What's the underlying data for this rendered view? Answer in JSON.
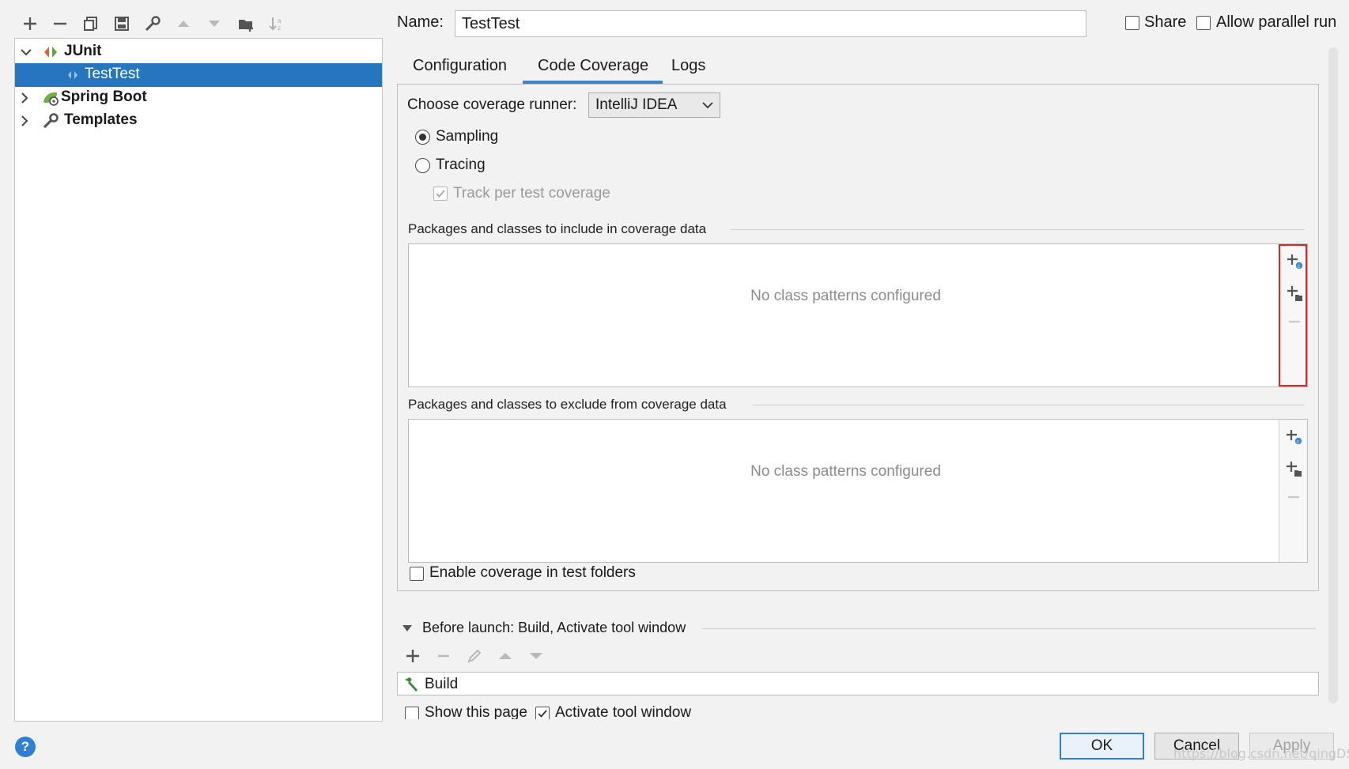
{
  "toolbar": {
    "icons": [
      "add-icon",
      "remove-icon",
      "copy-icon",
      "save-icon",
      "wrench-icon",
      "move-up-icon",
      "move-down-icon",
      "new-folder-icon",
      "sort-icon"
    ]
  },
  "tree": {
    "items": [
      {
        "label": "JUnit",
        "expanded": true,
        "icon": "junit-icon"
      },
      {
        "label": "TestTest",
        "selected": true,
        "icon": "test-config-icon"
      },
      {
        "label": "Spring Boot",
        "expanded": false,
        "icon": "spring-boot-icon"
      },
      {
        "label": "Templates",
        "expanded": false,
        "icon": "wrench-icon"
      }
    ]
  },
  "header": {
    "name_label": "Name:",
    "name_value": "TestTest",
    "share_label": "Share",
    "share_checked": false,
    "parallel_label": "Allow parallel run",
    "parallel_checked": false
  },
  "tabs": [
    {
      "label": "Configuration",
      "active": false
    },
    {
      "label": "Code Coverage",
      "active": true
    },
    {
      "label": "Logs",
      "active": false
    }
  ],
  "coverage": {
    "runner_label": "Choose coverage runner:",
    "runner_value": "IntelliJ IDEA",
    "sampling_label": "Sampling",
    "sampling_selected": true,
    "tracing_label": "Tracing",
    "tracing_selected": false,
    "track_label": "Track per test coverage",
    "track_checked": true,
    "include_title": "Packages and classes to include in coverage data",
    "include_empty": "No class patterns configured",
    "exclude_title": "Packages and classes to exclude from coverage data",
    "exclude_empty": "No class patterns configured",
    "enable_test_folders_label": "Enable coverage in test folders",
    "enable_test_folders_checked": false
  },
  "before_launch": {
    "title": "Before launch: Build, Activate tool window",
    "tools": [
      "add-icon",
      "remove-icon",
      "edit-icon",
      "move-up-icon",
      "move-down-icon"
    ],
    "items": [
      {
        "label": "Build",
        "icon": "hammer-icon"
      }
    ],
    "show_page_label": "Show this page",
    "show_page_checked": false,
    "activate_label": "Activate tool window",
    "activate_checked": true
  },
  "buttons": {
    "help": "?",
    "ok": "OK",
    "cancel": "Cancel",
    "apply": "Apply"
  },
  "watermark": "https://blog.csdn.net/qingDSL",
  "colors": {
    "selection": "#2675bf",
    "accent": "#3e84c8",
    "highlight_border": "#e02424"
  }
}
